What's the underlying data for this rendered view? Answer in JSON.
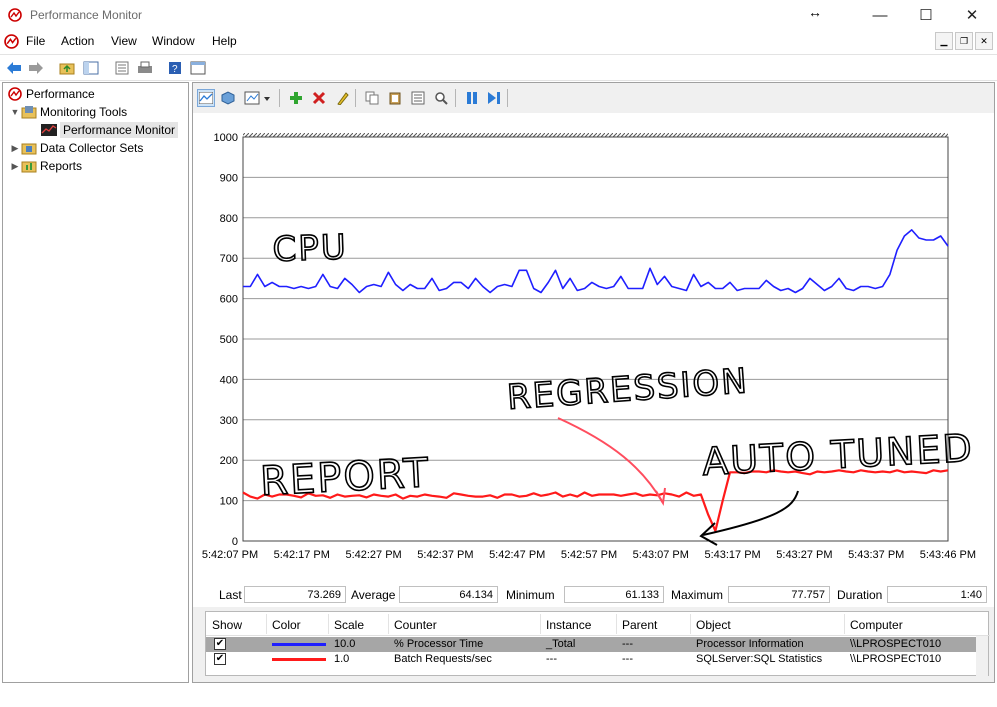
{
  "window": {
    "title": "Performance Monitor"
  },
  "menu": [
    "File",
    "Action",
    "View",
    "Window",
    "Help"
  ],
  "tree": {
    "root": "Performance",
    "items": [
      {
        "label": "Monitoring Tools"
      },
      {
        "label": "Performance Monitor"
      },
      {
        "label": "Data Collector Sets"
      },
      {
        "label": "Reports"
      }
    ]
  },
  "colors": {
    "cpu_series": "#1f1fff",
    "batch_series": "#ff1a1a",
    "annotation_ink": "#000000",
    "annotation_arrow": "#ff4d5e"
  },
  "chart_data": {
    "type": "line",
    "ylim": [
      0,
      1000
    ],
    "yticks": [
      "0",
      "100",
      "200",
      "300",
      "400",
      "500",
      "600",
      "700",
      "800",
      "900",
      "1000"
    ],
    "xticks": [
      "5:42:07 PM",
      "5:42:17 PM",
      "5:42:27 PM",
      "5:42:37 PM",
      "5:42:47 PM",
      "5:42:57 PM",
      "5:43:07 PM",
      "5:43:17 PM",
      "5:43:27 PM",
      "5:43:37 PM",
      "5:43:46 PM"
    ],
    "grid": true,
    "series": [
      {
        "name": "% Processor Time",
        "values": [
          630,
          630,
          660,
          630,
          640,
          630,
          630,
          625,
          630,
          625,
          630,
          660,
          630,
          625,
          650,
          635,
          615,
          630,
          635,
          630,
          665,
          635,
          620,
          635,
          625,
          625,
          650,
          620,
          625,
          640,
          640,
          625,
          650,
          630,
          615,
          630,
          635,
          630,
          670,
          670,
          625,
          615,
          640,
          670,
          625,
          650,
          620,
          625,
          640,
          630,
          625,
          630,
          655,
          625,
          625,
          625,
          675,
          635,
          655,
          630,
          625,
          620,
          660,
          630,
          640,
          625,
          625,
          640,
          620,
          625,
          625,
          625,
          645,
          630,
          620,
          625,
          615,
          625,
          650,
          635,
          620,
          630,
          650,
          625,
          620,
          630,
          630,
          625,
          630,
          660,
          720,
          755,
          770,
          750,
          745,
          745,
          755,
          730
        ]
      },
      {
        "name": "Batch Requests/sec",
        "values": [
          120,
          110,
          105,
          115,
          110,
          115,
          115,
          112,
          108,
          118,
          112,
          113,
          107,
          115,
          110,
          112,
          113,
          108,
          115,
          112,
          110,
          115,
          105,
          112,
          110,
          115,
          112,
          110,
          107,
          118,
          115,
          112,
          110,
          110,
          113,
          107,
          115,
          115,
          110,
          112,
          118,
          112,
          115,
          120,
          110,
          115,
          110,
          120,
          112,
          115,
          115,
          115,
          112,
          115,
          118,
          112,
          115,
          113,
          118,
          115,
          110,
          120,
          112,
          115,
          65,
          25,
          100,
          170,
          170,
          168,
          172,
          172,
          170,
          175,
          172,
          170,
          172,
          168,
          165,
          172,
          170,
          172,
          175,
          172,
          170,
          175,
          172,
          170,
          172,
          170,
          175,
          170,
          172,
          170,
          168,
          175,
          172,
          175
        ]
      }
    ]
  },
  "annotations": [
    "CPU",
    "REPORT",
    "REGRESSION",
    "AUTO TUNED"
  ],
  "stats": {
    "last_label": "Last",
    "last": "73.269",
    "average_label": "Average",
    "average": "64.134",
    "minimum_label": "Minimum",
    "minimum": "61.133",
    "maximum_label": "Maximum",
    "maximum": "77.757",
    "duration_label": "Duration",
    "duration": "1:40"
  },
  "legend": {
    "headers": [
      "Show",
      "Color",
      "Scale",
      "Counter",
      "Instance",
      "Parent",
      "Object",
      "Computer"
    ],
    "rows": [
      {
        "show": "✔",
        "scale": "10.0",
        "counter": "% Processor Time",
        "instance": "_Total",
        "parent": "---",
        "object": "Processor Information",
        "computer": "\\\\LPROSPECT010"
      },
      {
        "show": "✔",
        "scale": "1.0",
        "counter": "Batch Requests/sec",
        "instance": "---",
        "parent": "---",
        "object": "SQLServer:SQL Statistics",
        "computer": "\\\\LPROSPECT010"
      }
    ]
  }
}
